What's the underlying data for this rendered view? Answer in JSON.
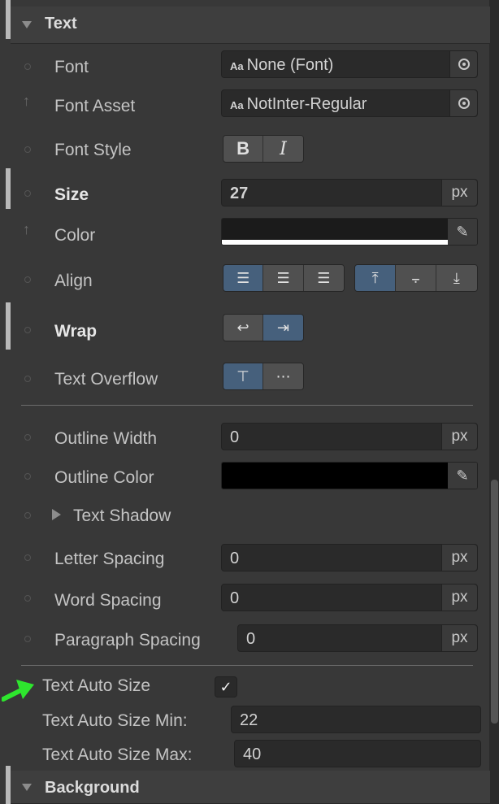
{
  "sections": {
    "text_header": "Text",
    "background_header": "Background"
  },
  "rows": {
    "font": {
      "label": "Font",
      "value": "None (Font)",
      "prefix": "Aa"
    },
    "font_asset": {
      "label": "Font Asset",
      "value": "NotInter-Regular",
      "prefix": "Aa"
    },
    "font_style": {
      "label": "Font Style",
      "bold": "B",
      "italic": "I"
    },
    "size": {
      "label": "Size",
      "value": "27",
      "unit": "px"
    },
    "color": {
      "label": "Color",
      "swatch": "#1b1b1b"
    },
    "align": {
      "label": "Align"
    },
    "wrap": {
      "label": "Wrap"
    },
    "text_overflow": {
      "label": "Text Overflow"
    },
    "outline_width": {
      "label": "Outline Width",
      "value": "0",
      "unit": "px"
    },
    "outline_color": {
      "label": "Outline Color",
      "swatch": "#000000"
    },
    "text_shadow": {
      "label": "Text Shadow"
    },
    "letter_spacing": {
      "label": "Letter Spacing",
      "value": "0",
      "unit": "px"
    },
    "word_spacing": {
      "label": "Word Spacing",
      "value": "0",
      "unit": "px"
    },
    "paragraph_spacing": {
      "label": "Paragraph Spacing",
      "value": "0",
      "unit": "px"
    }
  },
  "auto_size": {
    "label": "Text Auto Size",
    "checked": true,
    "min_label": "Text Auto Size Min:",
    "min_value": "22",
    "max_label": "Text Auto Size Max:",
    "max_value": "40"
  },
  "colors": {
    "panel_bg": "#383838",
    "active_button": "#46607c",
    "annotation_arrow": "#2ee62e"
  },
  "icons": {
    "picker": "object-picker-icon",
    "eyedropper": "eyedropper-icon",
    "check": "checkmark-icon"
  }
}
